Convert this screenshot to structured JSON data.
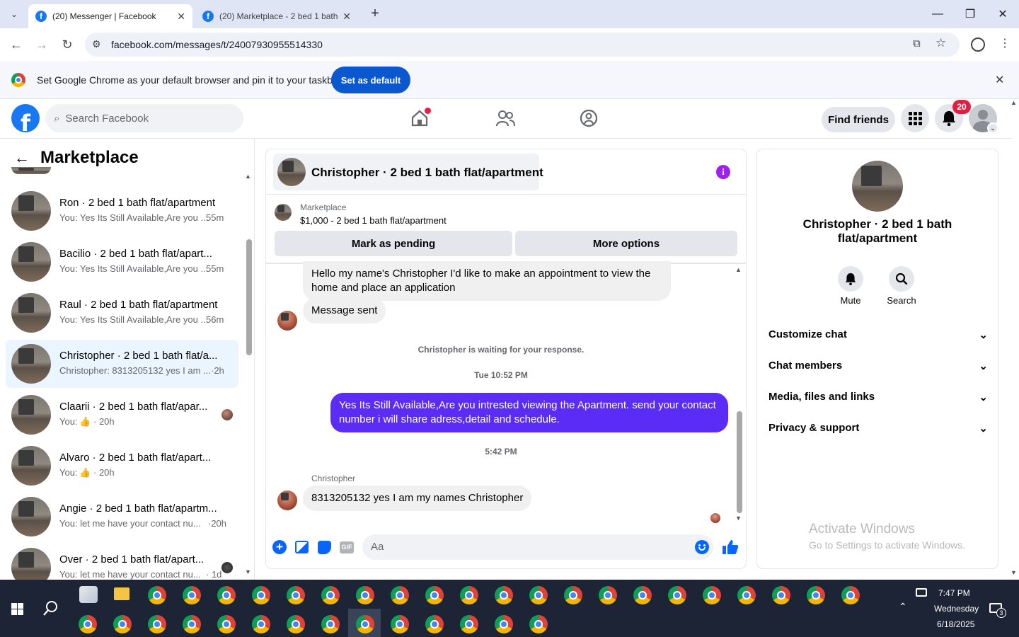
{
  "browser": {
    "tabs": [
      {
        "title": "(20) Messenger | Facebook",
        "active": true
      },
      {
        "title": "(20) Marketplace - 2 bed 1 bath",
        "active": false
      }
    ],
    "url": "facebook.com/messages/t/24007930955514330",
    "infobar_text": "Set Google Chrome as your default browser and pin it to your taskbar",
    "infobar_button": "Set as default"
  },
  "fb": {
    "search_placeholder": "Search Facebook",
    "find_friends": "Find friends",
    "notif_count": "20",
    "brand_color": "#1877f2"
  },
  "sidebar": {
    "title": "Marketplace",
    "conversations": [
      {
        "name": "Ron · 2 bed 1 bath flat/apartment",
        "preview": "You: Yes Its Still Available,Are you ...",
        "time": "55m"
      },
      {
        "name": "Bacilio · 2 bed 1 bath flat/apart...",
        "preview": "You: Yes Its Still Available,Are you ...",
        "time": "55m"
      },
      {
        "name": "Raul · 2 bed 1 bath flat/apartment",
        "preview": "You: Yes Its Still Available,Are you ...",
        "time": "56m"
      },
      {
        "name": "Christopher · 2 bed 1 bath flat/a...",
        "preview": "Christopher: 8313205132 yes I am ...",
        "time": "·2h",
        "selected": true
      },
      {
        "name": "Claarii · 2 bed 1 bath flat/apar...",
        "preview": "You:",
        "time": "· 20h"
      },
      {
        "name": "Alvaro · 2 bed 1 bath flat/apart...",
        "preview": "You:",
        "time": "· 20h"
      },
      {
        "name": "Angie · 2 bed 1 bath flat/apartm...",
        "preview": "You: let me have your contact nu...",
        "time": "·20h"
      },
      {
        "name": "Over · 2 bed 1 bath flat/apart...",
        "preview": "You: let me have your contact nu...",
        "time": "· 1d"
      }
    ]
  },
  "chat": {
    "header_title": "Christopher · 2 bed 1 bath flat/apartment",
    "listing_label": "Marketplace",
    "listing_detail": "$1,000 - 2 bed 1 bath flat/apartment",
    "mark_pending": "Mark as pending",
    "more_options": "More options",
    "msg1": "Hello my name's Christopher I'd like to make an appointment to view the home and place an application",
    "msg2": "Message sent",
    "waiting": "Christopher is waiting for your response.",
    "ts1": "Tue 10:52 PM",
    "out_msg": "Yes Its Still Available,Are you intrested viewing the Apartment. send your contact number i will share adress,detail and schedule.",
    "ts2": "5:42 PM",
    "sender": "Christopher",
    "msg3": "8313205132 yes I am my names Christopher",
    "composer_placeholder": "Aa",
    "accent_color": "#5b2cf5"
  },
  "info": {
    "name": "Christopher · 2 bed 1 bath flat/apartment",
    "mute": "Mute",
    "search": "Search",
    "rows": [
      "Customize chat",
      "Chat members",
      "Media, files and links",
      "Privacy & support"
    ],
    "watermark_title": "Activate Windows",
    "watermark_sub": "Go to Settings to activate Windows."
  },
  "taskbar": {
    "time": "7:47 PM",
    "day": "Wednesday",
    "date": "6/18/2025",
    "notif_badge": "3"
  }
}
